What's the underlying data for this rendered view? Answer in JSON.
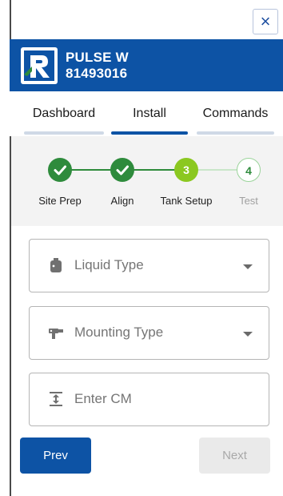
{
  "window": {
    "close_label": "×"
  },
  "header": {
    "device_name": "PULSE W",
    "device_id": "81493016"
  },
  "tabs": [
    {
      "label": "Dashboard",
      "active": false
    },
    {
      "label": "Install",
      "active": true
    },
    {
      "label": "Commands",
      "active": false
    }
  ],
  "steps": [
    {
      "label": "Site Prep",
      "status": "complete"
    },
    {
      "label": "Align",
      "status": "complete"
    },
    {
      "label": "Tank Setup",
      "number": "3",
      "status": "current"
    },
    {
      "label": "Test",
      "number": "4",
      "status": "pending"
    }
  ],
  "form": {
    "liquid_type": {
      "placeholder": "Liquid Type",
      "icon": "bottle-icon"
    },
    "mounting_type": {
      "placeholder": "Mounting Type",
      "icon": "mount-icon"
    },
    "enter_cm": {
      "placeholder": "Enter CM",
      "icon": "vertical-height-icon"
    }
  },
  "buttons": {
    "prev_label": "Prev",
    "next_label": "Next"
  },
  "colors": {
    "brand_blue": "#0d53a5",
    "step_green": "#2e8b3c",
    "current_green": "#8bc820",
    "highlight_yellow": "#f3f76a"
  }
}
